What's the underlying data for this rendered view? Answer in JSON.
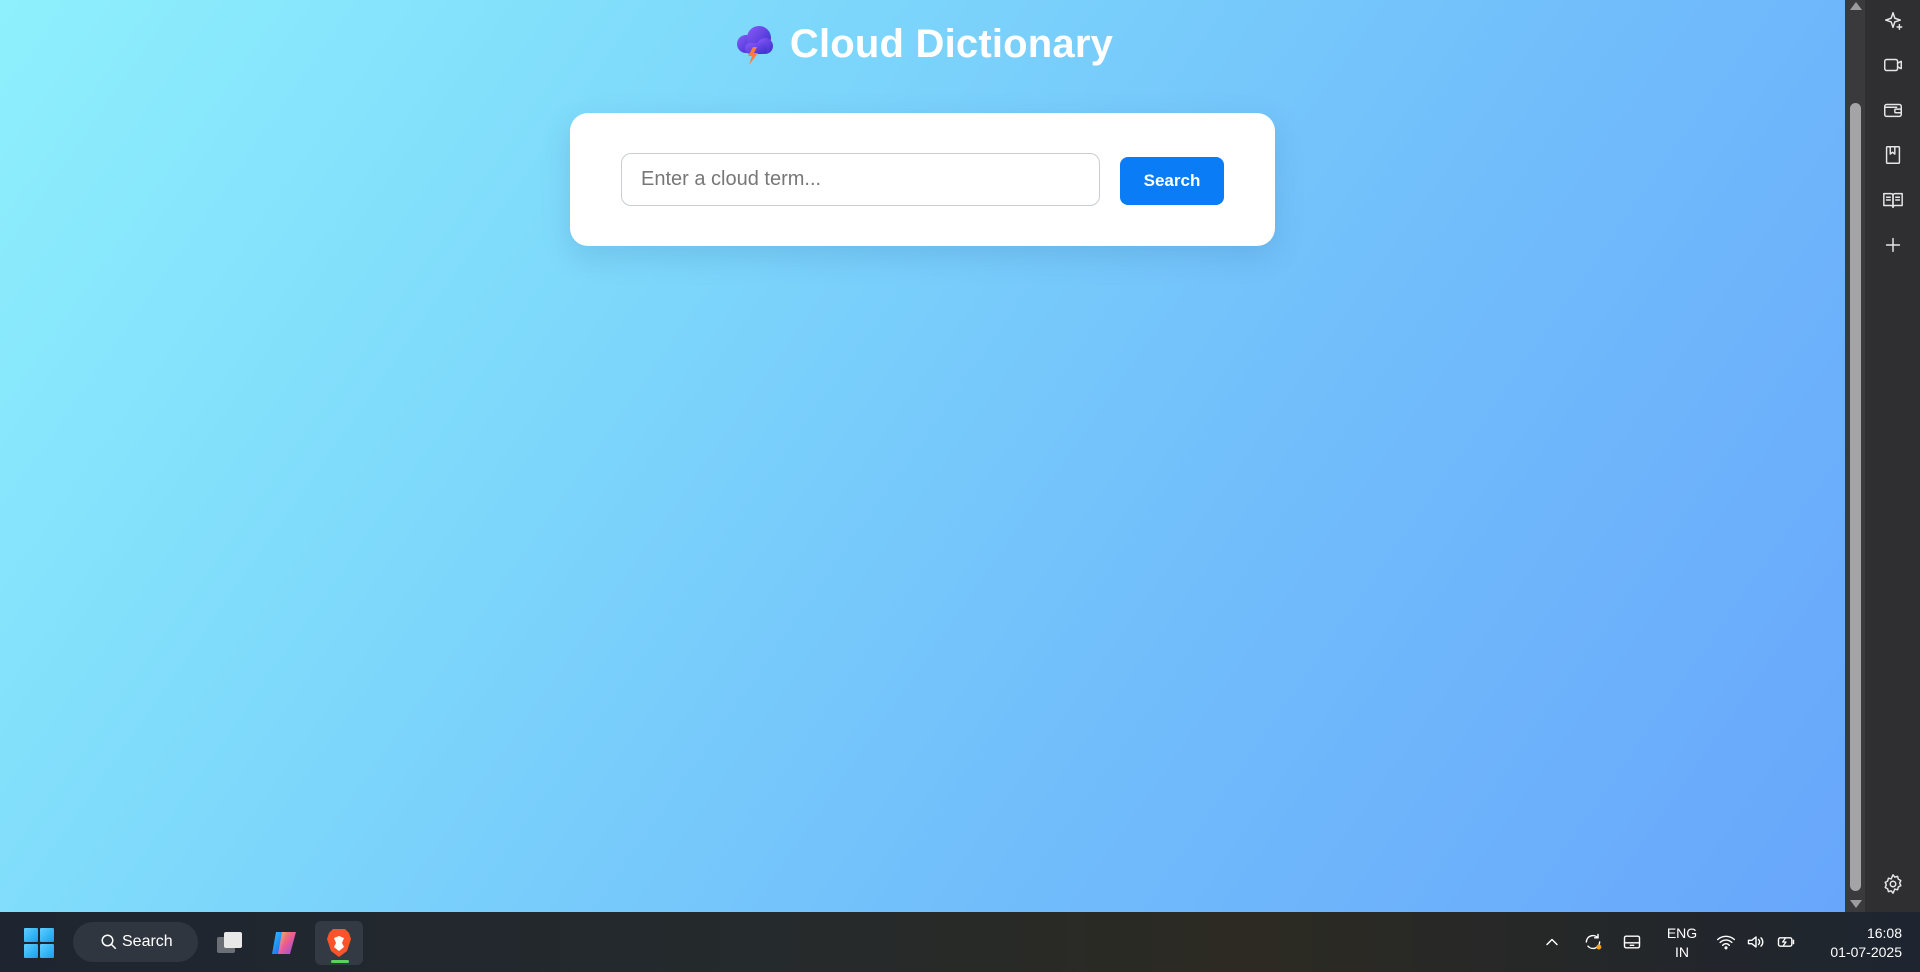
{
  "app": {
    "title": "Cloud Dictionary",
    "logo_icon": "cloud-lightning-icon"
  },
  "search": {
    "placeholder": "Enter a cloud term...",
    "value": "",
    "button_label": "Search"
  },
  "browser_sidebar": {
    "items": [
      {
        "icon": "leo-ai-icon"
      },
      {
        "icon": "video-call-icon"
      },
      {
        "icon": "wallet-icon"
      },
      {
        "icon": "bookmarks-icon"
      },
      {
        "icon": "reading-list-icon"
      },
      {
        "icon": "add-icon"
      },
      {
        "icon": "settings-icon"
      }
    ]
  },
  "taskbar": {
    "search_label": "Search",
    "apps": [
      {
        "icon": "task-view-icon"
      },
      {
        "icon": "copilot-icon"
      },
      {
        "icon": "brave-browser-icon",
        "active": true
      }
    ],
    "tray": {
      "language_line1": "ENG",
      "language_line2": "IN",
      "time": "16:08",
      "date": "01-07-2025"
    }
  },
  "colors": {
    "accent": "#0a7cf6",
    "gradient_start": "#8ef0fc",
    "gradient_end": "#68a6fb",
    "card": "#ffffff"
  }
}
